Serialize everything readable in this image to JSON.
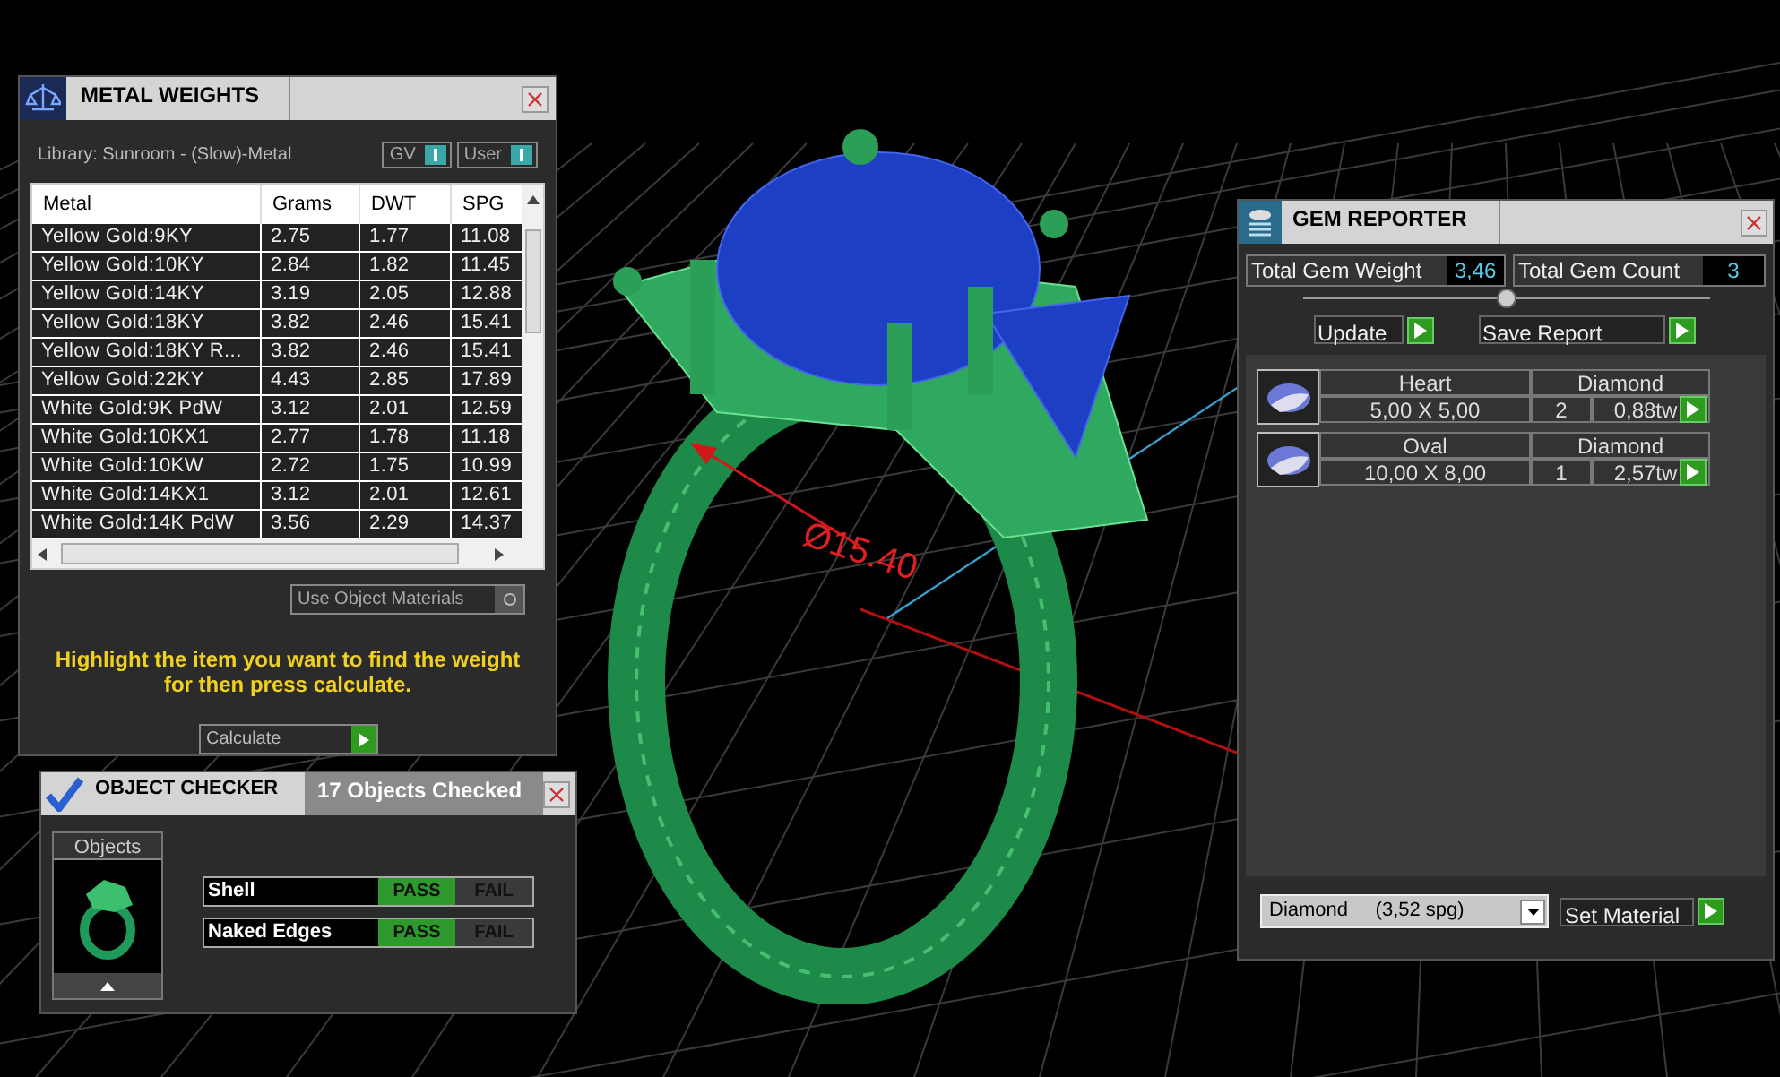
{
  "viewport": {
    "dimension_label": "Ø15.40"
  },
  "metal_weights": {
    "title": "METAL WEIGHTS",
    "library": "Library: Sunroom - (Slow)-Metal",
    "toggles": [
      {
        "label": "GV",
        "on": true
      },
      {
        "label": "User",
        "on": true
      }
    ],
    "columns": [
      "Metal",
      "Grams",
      "DWT",
      "SPG"
    ],
    "rows": [
      [
        "Yellow Gold:9KY",
        "2.75",
        "1.77",
        "11.08"
      ],
      [
        "Yellow Gold:10KY",
        "2.84",
        "1.82",
        "11.45"
      ],
      [
        "Yellow Gold:14KY",
        "3.19",
        "2.05",
        "12.88"
      ],
      [
        "Yellow Gold:18KY",
        "3.82",
        "2.46",
        "15.41"
      ],
      [
        "Yellow Gold:18KY R...",
        "3.82",
        "2.46",
        "15.41"
      ],
      [
        "Yellow Gold:22KY",
        "4.43",
        "2.85",
        "17.89"
      ],
      [
        "White Gold:9K PdW",
        "3.12",
        "2.01",
        "12.59"
      ],
      [
        "White Gold:10KX1",
        "2.77",
        "1.78",
        "11.18"
      ],
      [
        "White Gold:10KW",
        "2.72",
        "1.75",
        "10.99"
      ],
      [
        "White Gold:14KX1",
        "3.12",
        "2.01",
        "12.61"
      ],
      [
        "White Gold:14K PdW",
        "3.56",
        "2.29",
        "14.37"
      ]
    ],
    "use_object_materials": {
      "label": "Use Object Materials",
      "on": false
    },
    "hint": "Highlight the item you want to find the weight for then press calculate.",
    "calculate": "Calculate"
  },
  "object_checker": {
    "title": "OBJECT CHECKER",
    "status": "17  Objects Checked",
    "objects_label": "Objects",
    "checks": [
      {
        "name": "Shell",
        "pass_label": "PASS",
        "fail_label": "FAIL",
        "passed": true
      },
      {
        "name": "Naked Edges",
        "pass_label": "PASS",
        "fail_label": "FAIL",
        "passed": true
      }
    ]
  },
  "gem_reporter": {
    "title": "GEM REPORTER",
    "total_weight_label": "Total Gem Weight",
    "total_weight": "3,46",
    "total_count_label": "Total Gem Count",
    "total_count": "3",
    "update": "Update",
    "save_report": "Save Report",
    "gems": [
      {
        "shape": "Heart",
        "material": "Diamond",
        "size": "5,00 X 5,00",
        "count": "2",
        "weight": "0,88tw"
      },
      {
        "shape": "Oval",
        "material": "Diamond",
        "size": "10,00 X 8,00",
        "count": "1",
        "weight": "2,57tw"
      }
    ],
    "material_select": "Diamond     (3,52 spg)",
    "set_material": "Set Material"
  }
}
